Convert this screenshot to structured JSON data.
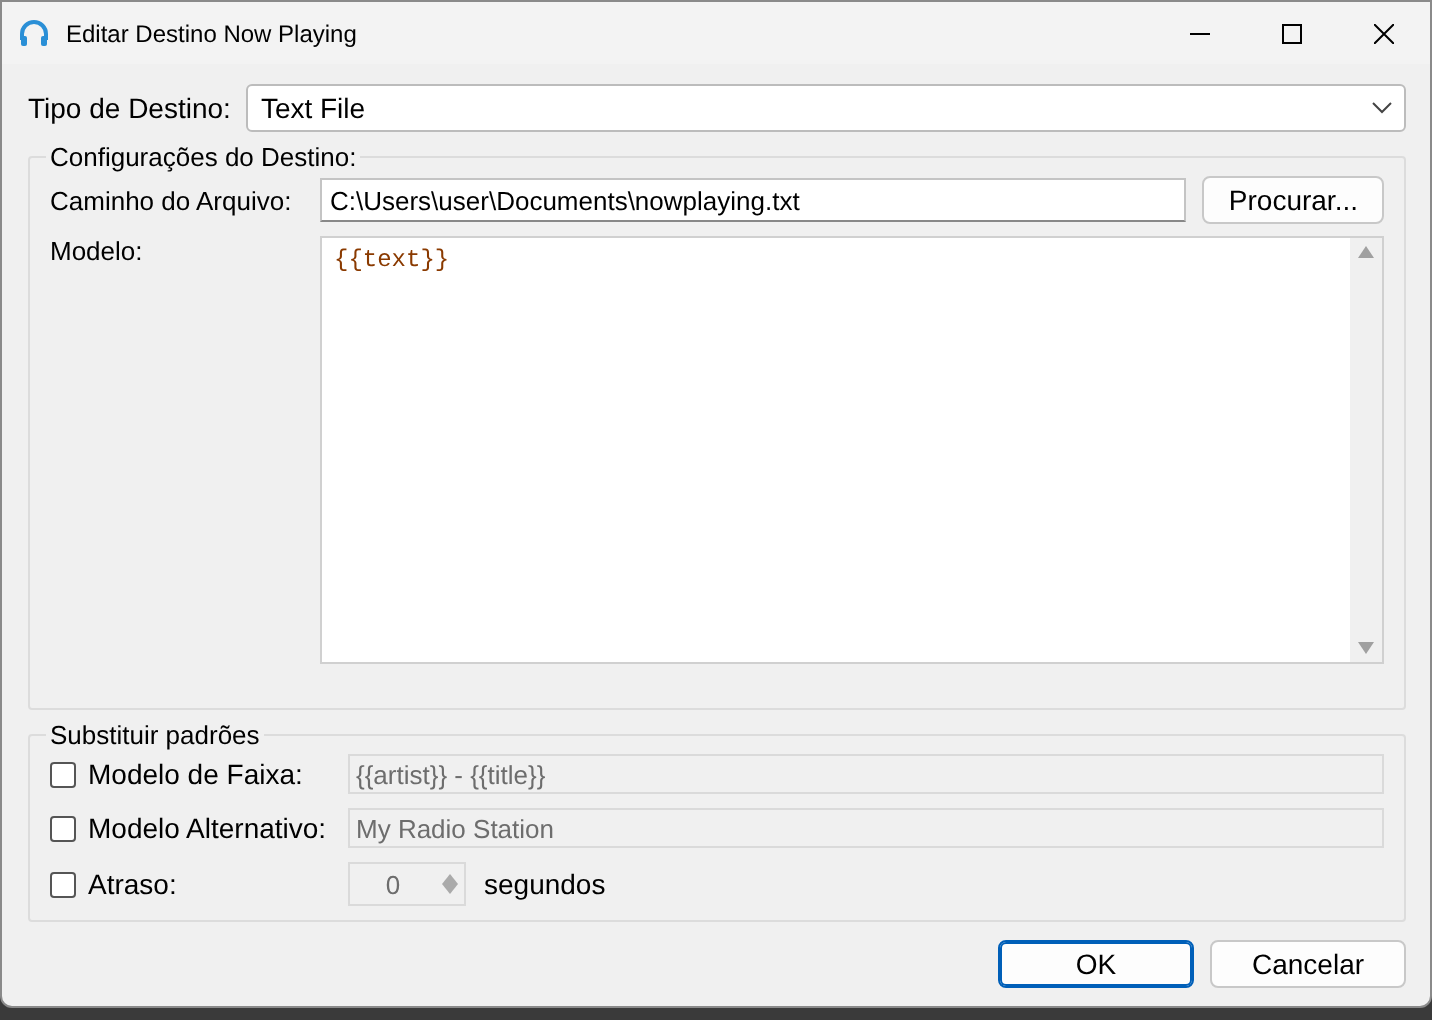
{
  "window": {
    "title": "Editar Destino Now Playing"
  },
  "destination_type": {
    "label": "Tipo de Destino:",
    "value": "Text File"
  },
  "destination_settings": {
    "title": "Configurações do Destino:",
    "file_path": {
      "label": "Caminho do Arquivo:",
      "value": "C:\\Users\\user\\Documents\\nowplaying.txt"
    },
    "browse_button": "Procurar...",
    "template": {
      "label": "Modelo:",
      "value": "{{text}}"
    }
  },
  "override": {
    "title": "Substituir padrões",
    "rows": [
      {
        "kind": "text",
        "label": "Modelo de Faixa:",
        "checked": false,
        "value": "{{artist}} - {{title}}",
        "disabled": true
      },
      {
        "kind": "text",
        "label": "Modelo Alternativo:",
        "checked": false,
        "value": "My Radio Station",
        "disabled": true
      },
      {
        "kind": "spinner",
        "label": "Atraso:",
        "checked": false,
        "value": "0",
        "disabled": true,
        "unit": "segundos"
      }
    ]
  },
  "buttons": [
    {
      "label": "OK",
      "default": true
    },
    {
      "label": "Cancelar",
      "default": false
    }
  ]
}
